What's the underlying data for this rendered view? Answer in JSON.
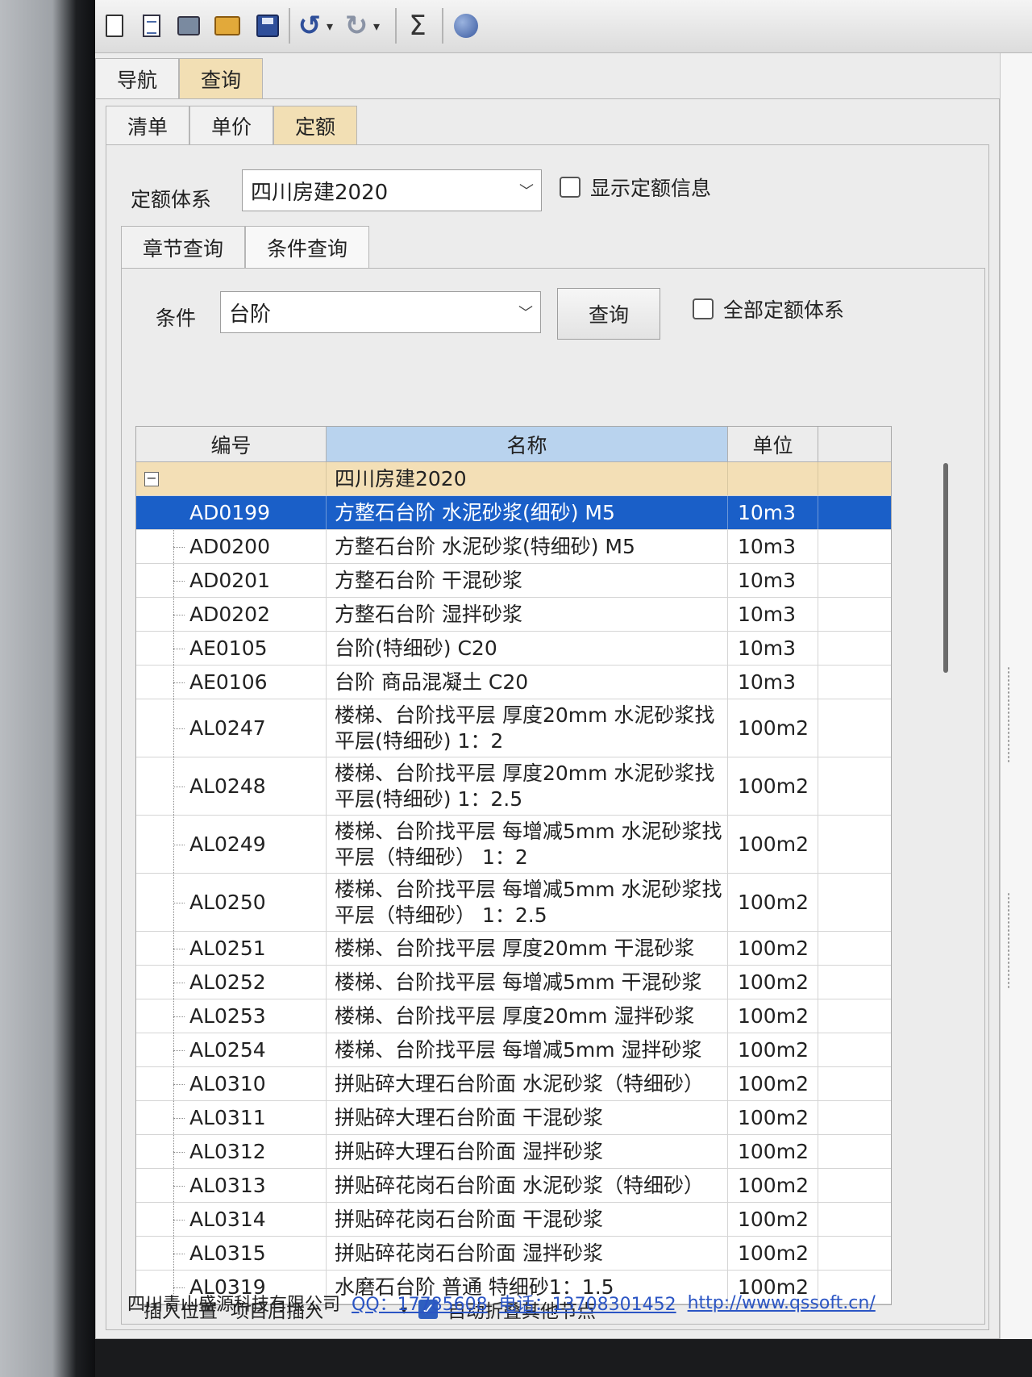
{
  "toolbar": {
    "icons": [
      "new-doc-icon",
      "doc-icon",
      "print-icon",
      "open-folder-icon",
      "save-icon",
      "undo-icon",
      "redo-icon",
      "sum-icon",
      "globe-icon"
    ],
    "undo_glyph": "↺",
    "redo_glyph": "↻",
    "caret_glyph": "▾",
    "sum_glyph": "Σ"
  },
  "main_tabs": [
    {
      "label": "导航"
    },
    {
      "label": "查询"
    }
  ],
  "sub_tabs": [
    {
      "label": "清单"
    },
    {
      "label": "单价"
    },
    {
      "label": "定额"
    }
  ],
  "quota_system": {
    "label": "定额体系",
    "value": "四川房建2020",
    "show_info_label": "显示定额信息"
  },
  "query_tabs": [
    {
      "label": "章节查询"
    },
    {
      "label": "条件查询"
    }
  ],
  "condition": {
    "label": "条件",
    "value": "台阶",
    "query_button": "查询",
    "all_systems_label": "全部定额体系"
  },
  "grid": {
    "headers": {
      "code": "编号",
      "name": "名称",
      "unit": "单位"
    },
    "group": {
      "name": "四川房建2020",
      "collapse_glyph": "−"
    },
    "rows": [
      {
        "code": "AD0199",
        "name": "方整石台阶 水泥砂浆(细砂) M5",
        "unit": "10m3"
      },
      {
        "code": "AD0200",
        "name": "方整石台阶 水泥砂浆(特细砂) M5",
        "unit": "10m3"
      },
      {
        "code": "AD0201",
        "name": "方整石台阶 干混砂浆",
        "unit": "10m3"
      },
      {
        "code": "AD0202",
        "name": "方整石台阶 湿拌砂浆",
        "unit": "10m3"
      },
      {
        "code": "AE0105",
        "name": "台阶(特细砂) C20",
        "unit": "10m3"
      },
      {
        "code": "AE0106",
        "name": "台阶 商品混凝土 C20",
        "unit": "10m3"
      },
      {
        "code": "AL0247",
        "name": "楼梯、台阶找平层 厚度20mm 水泥砂浆找平层(特细砂) 1：2",
        "unit": "100m2"
      },
      {
        "code": "AL0248",
        "name": "楼梯、台阶找平层 厚度20mm 水泥砂浆找平层(特细砂) 1：2.5",
        "unit": "100m2"
      },
      {
        "code": "AL0249",
        "name": "楼梯、台阶找平层 每增减5mm 水泥砂浆找平层（特细砂） 1：2",
        "unit": "100m2"
      },
      {
        "code": "AL0250",
        "name": "楼梯、台阶找平层 每增减5mm 水泥砂浆找平层（特细砂） 1：2.5",
        "unit": "100m2"
      },
      {
        "code": "AL0251",
        "name": "楼梯、台阶找平层 厚度20mm 干混砂浆",
        "unit": "100m2"
      },
      {
        "code": "AL0252",
        "name": "楼梯、台阶找平层 每增减5mm 干混砂浆",
        "unit": "100m2"
      },
      {
        "code": "AL0253",
        "name": "楼梯、台阶找平层 厚度20mm 湿拌砂浆",
        "unit": "100m2"
      },
      {
        "code": "AL0254",
        "name": "楼梯、台阶找平层 每增减5mm 湿拌砂浆",
        "unit": "100m2"
      },
      {
        "code": "AL0310",
        "name": "拼贴碎大理石台阶面 水泥砂浆（特细砂）",
        "unit": "100m2"
      },
      {
        "code": "AL0311",
        "name": "拼贴碎大理石台阶面 干混砂浆",
        "unit": "100m2"
      },
      {
        "code": "AL0312",
        "name": "拼贴碎大理石台阶面 湿拌砂浆",
        "unit": "100m2"
      },
      {
        "code": "AL0313",
        "name": "拼贴碎花岗石台阶面 水泥砂浆（特细砂）",
        "unit": "100m2"
      },
      {
        "code": "AL0314",
        "name": "拼贴碎花岗石台阶面 干混砂浆",
        "unit": "100m2"
      },
      {
        "code": "AL0315",
        "name": "拼贴碎花岗石台阶面 湿拌砂浆",
        "unit": "100m2"
      },
      {
        "code": "AL0319",
        "name": "水磨石台阶 普通 特细砂1：1.5",
        "unit": "100m2"
      }
    ]
  },
  "bottom": {
    "insert_label": "插入位置",
    "insert_value": "项目后插入",
    "insert_caret": "▾",
    "auto_collapse_label": "自动折叠其他节点",
    "check_glyph": "✓"
  },
  "footer": {
    "company": "四川青山盛源科技有限公司",
    "qq": "QQ：17785608",
    "phone": "电话：13708301452",
    "url": "http://www.qssoft.cn/"
  },
  "colors": {
    "active_tab": "#f2dfb4",
    "selected_row": "#1a5fc8",
    "group_row": "#f3dfb6",
    "sorted_header": "#b9d3ee",
    "link": "#2b55c4"
  }
}
